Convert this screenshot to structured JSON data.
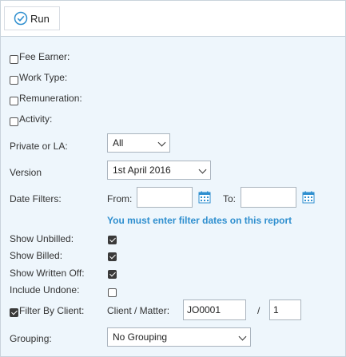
{
  "toolbar": {
    "run_label": "Run"
  },
  "filters": {
    "fee_earner_label": "Fee Earner:",
    "work_type_label": "Work Type:",
    "remuneration_label": "Remuneration:",
    "activity_label": "Activity:"
  },
  "private_or_la": {
    "label": "Private or LA:",
    "value": "All"
  },
  "version": {
    "label": "Version",
    "value": "1st April 2016"
  },
  "date_filters": {
    "label": "Date Filters:",
    "from_label": "From:",
    "from_value": "",
    "to_label": "To:",
    "to_value": "",
    "warning": "You must enter filter dates on this report"
  },
  "options": {
    "show_unbilled": {
      "label": "Show Unbilled:",
      "checked": true
    },
    "show_billed": {
      "label": "Show Billed:",
      "checked": true
    },
    "show_written_off": {
      "label": "Show Written Off:",
      "checked": true
    },
    "include_undone": {
      "label": "Include Undone:",
      "checked": false
    }
  },
  "client_filter": {
    "label": "Filter By Client:",
    "checked": true,
    "client_matter_label": "Client / Matter:",
    "client_value": "JO0001",
    "separator": "/",
    "matter_value": "1"
  },
  "grouping": {
    "label": "Grouping:",
    "value": "No Grouping"
  },
  "colors": {
    "panel_bg": "#eef6fc",
    "warning": "#2f8fcf",
    "run_icon": "#2f8fcf"
  }
}
